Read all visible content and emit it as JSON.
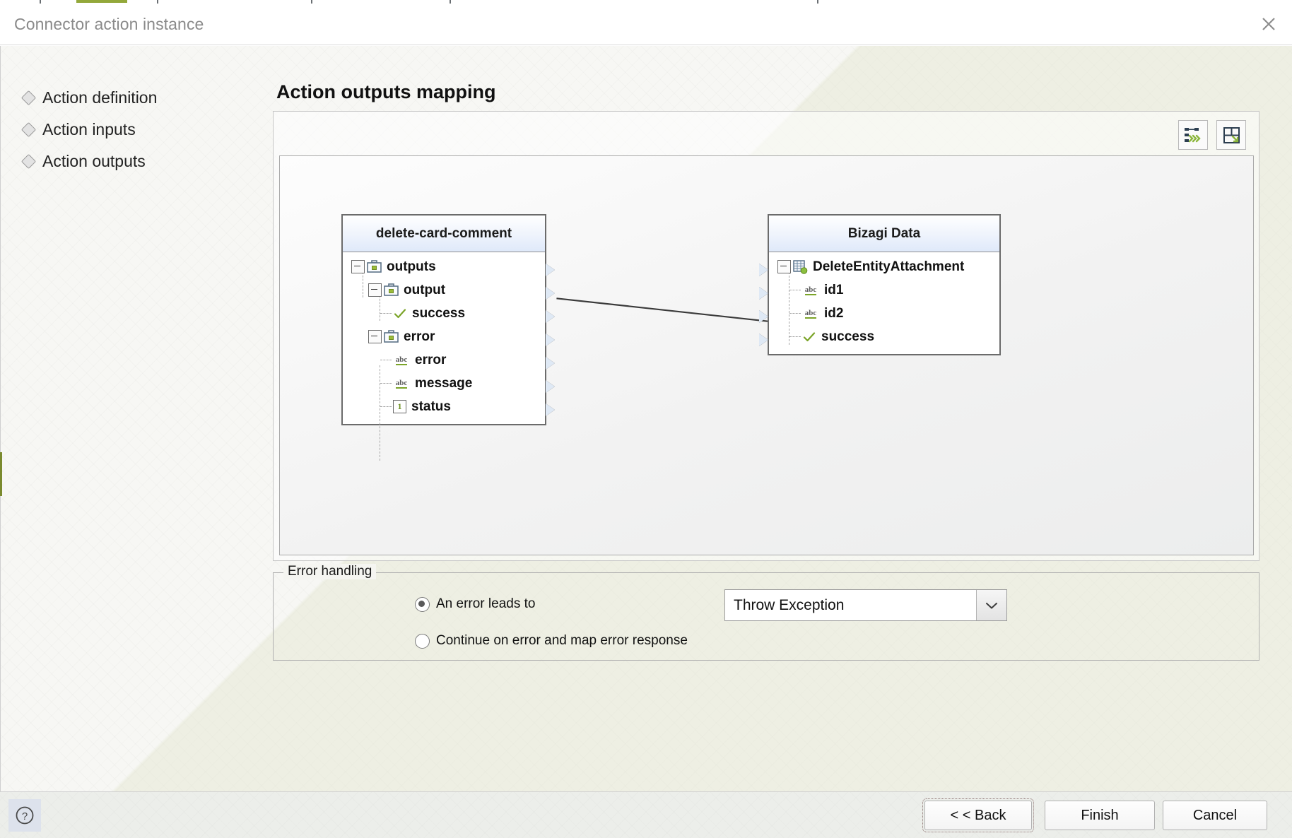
{
  "window": {
    "title": "Connector action instance",
    "close_icon": "close-icon"
  },
  "sidebar": {
    "items": [
      {
        "label": "Action definition"
      },
      {
        "label": "Action inputs"
      },
      {
        "label": "Action outputs"
      }
    ]
  },
  "main": {
    "heading": "Action outputs mapping",
    "toolbar": {
      "auto_map_label": "auto-map-icon",
      "fit_layout_label": "fit-layout-icon"
    }
  },
  "mapping": {
    "source": {
      "title": "delete-card-comment",
      "nodes": [
        {
          "label": "outputs",
          "type": "object",
          "depth": 0,
          "expanded": true
        },
        {
          "label": "output",
          "type": "object",
          "depth": 1,
          "expanded": true
        },
        {
          "label": "success",
          "type": "boolean",
          "depth": 2,
          "expanded": false
        },
        {
          "label": "error",
          "type": "object",
          "depth": 1,
          "expanded": true
        },
        {
          "label": "error",
          "type": "string",
          "depth": 2,
          "expanded": false
        },
        {
          "label": "message",
          "type": "string",
          "depth": 2,
          "expanded": false
        },
        {
          "label": "status",
          "type": "number",
          "depth": 2,
          "expanded": false
        }
      ]
    },
    "target": {
      "title": "Bizagi Data",
      "nodes": [
        {
          "label": "DeleteEntityAttachment",
          "type": "entity",
          "depth": 0,
          "expanded": true
        },
        {
          "label": "id1",
          "type": "string",
          "depth": 1,
          "expanded": false
        },
        {
          "label": "id2",
          "type": "string",
          "depth": 1,
          "expanded": false
        },
        {
          "label": "success",
          "type": "boolean",
          "depth": 1,
          "expanded": false
        }
      ]
    },
    "connections": [
      {
        "from": "success",
        "to": "success"
      }
    ]
  },
  "error_handling": {
    "legend": "Error handling",
    "options": [
      {
        "label": "An error leads to",
        "selected": true
      },
      {
        "label": "Continue on error and map error response",
        "selected": false
      }
    ],
    "action_select": {
      "value": "Throw Exception",
      "options": [
        "Throw Exception"
      ]
    }
  },
  "footer": {
    "help_label": "?",
    "back_label": "< < Back",
    "finish_label": "Finish",
    "cancel_label": "Cancel"
  },
  "colors": {
    "accent_green": "#7ba428",
    "header_blue": "#dfe9fa",
    "text": "#111111",
    "muted": "#8a8a8a"
  }
}
